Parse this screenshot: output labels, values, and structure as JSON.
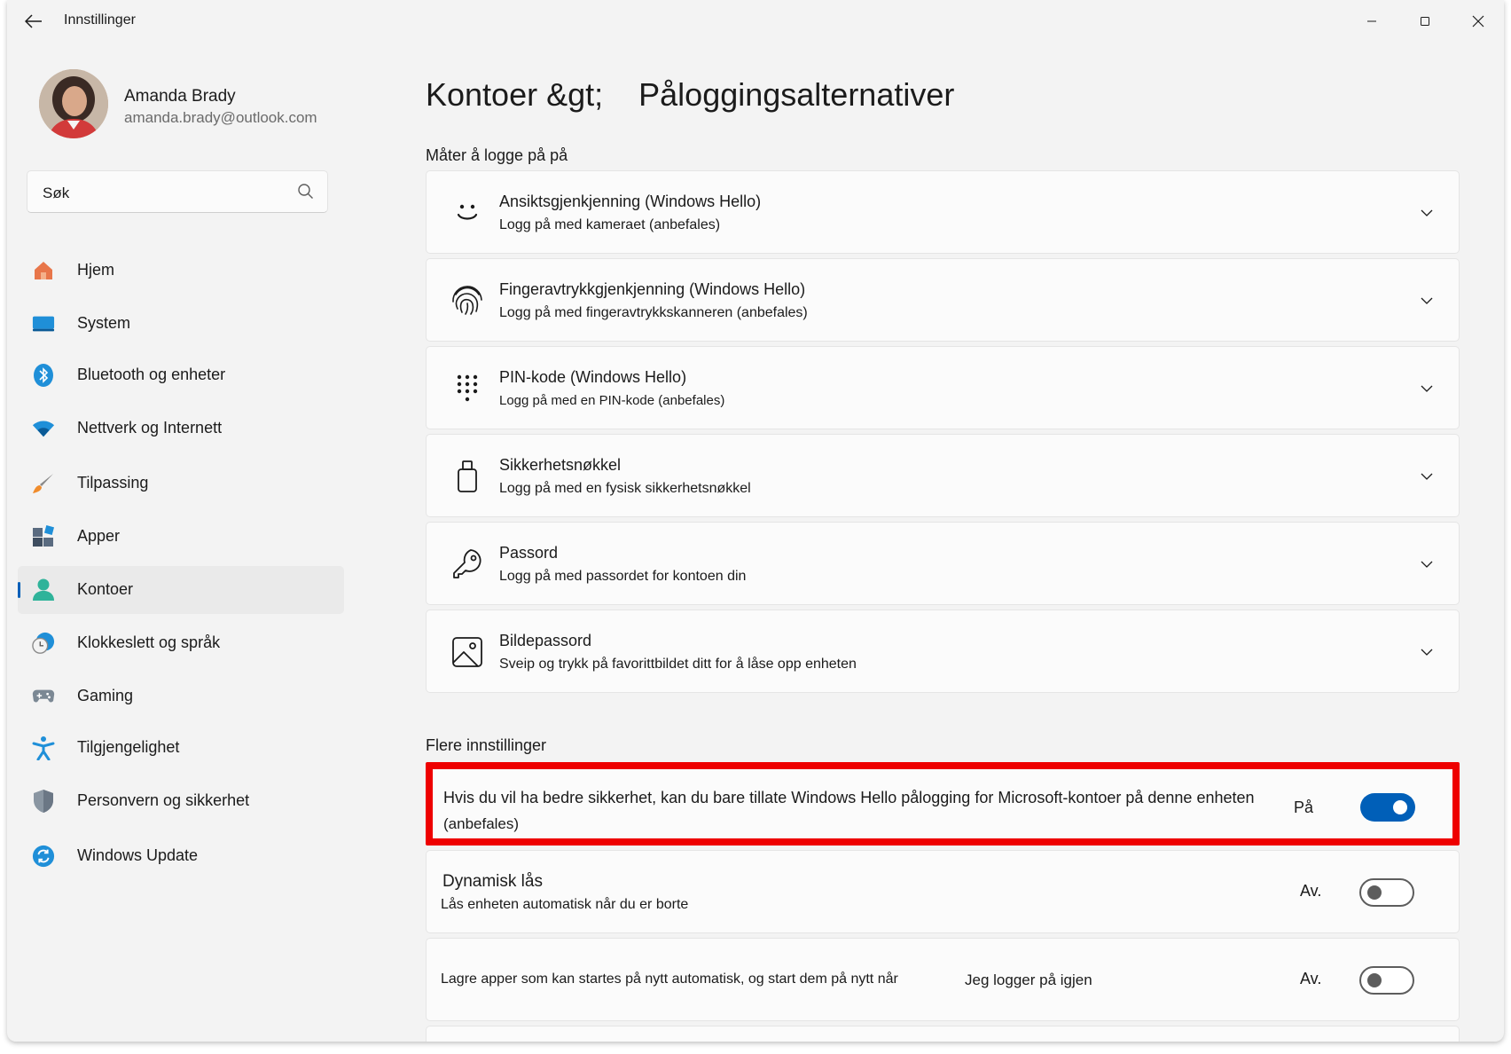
{
  "app": {
    "title": "Innstillinger"
  },
  "profile": {
    "name": "Amanda Brady",
    "email": "amanda.brady@outlook.com"
  },
  "search": {
    "placeholder": "Søk"
  },
  "nav": [
    {
      "label": "Hjem",
      "icon": "home-icon"
    },
    {
      "label": "System",
      "icon": "monitor-icon"
    },
    {
      "label": "Bluetooth og enheter",
      "icon": "bluetooth-icon"
    },
    {
      "label": "Nettverk og Internett",
      "icon": "wifi-icon"
    },
    {
      "label": "Tilpassing",
      "icon": "paintbrush-icon"
    },
    {
      "label": "Apper",
      "icon": "apps-icon"
    },
    {
      "label": "Kontoer",
      "icon": "person-icon",
      "selected": true
    },
    {
      "label": "Klokkeslett og språk",
      "icon": "clock-globe-icon"
    },
    {
      "label": "Gaming",
      "icon": "gamepad-icon"
    },
    {
      "label": "Tilgjengelighet",
      "icon": "accessibility-icon"
    },
    {
      "label": "Personvern og sikkerhet",
      "icon": "shield-icon"
    },
    {
      "label": "Windows Update",
      "icon": "refresh-icon"
    }
  ],
  "page": {
    "breadcrumb_parent": "Kontoer &gt;",
    "title": "Påloggingsalternativer"
  },
  "signin": {
    "section_title": "Måter å logge på på",
    "options": [
      {
        "title": "Ansiktsgjenkjenning (Windows Hello)",
        "subtitle": "Logg på med kameraet (anbefales)",
        "icon": "face-icon"
      },
      {
        "title": "Fingeravtrykkgjenkjenning (Windows Hello)",
        "subtitle": "Logg på med fingeravtrykkskanneren (anbefales)",
        "icon": "fingerprint-icon"
      },
      {
        "title": "PIN-kode (Windows Hello)",
        "subtitle": "Logg på med en  PIN-kode (anbefales)",
        "icon": "keypad-icon"
      },
      {
        "title": "Sikkerhetsnøkkel",
        "subtitle": "Logg på med en fysisk sikkerhetsnøkkel",
        "icon": "usb-key-icon"
      },
      {
        "title": "Passord",
        "subtitle": "Logg på med passordet for kontoen din",
        "icon": "key-icon"
      },
      {
        "title": "Bildepassord",
        "subtitle": "Sveip og trykk på favorittbildet ditt for å låse opp enheten",
        "icon": "picture-icon"
      }
    ]
  },
  "more": {
    "section_title": "Flere innstillinger",
    "hello_only": {
      "line1": "Hvis du vil ha bedre sikkerhet, kan du bare tillate Windows Hello pålogging for Microsoft-kontoer på denne enheten",
      "line2": "(anbefales)",
      "state": "På",
      "on": true
    },
    "dynamic_lock": {
      "title": "Dynamisk lås",
      "subtitle": "Lås enheten automatisk når du er borte",
      "state": "Av.",
      "on": false
    },
    "restart_apps": {
      "text": "Lagre apper som kan startes på nytt automatisk, og start dem på nytt når",
      "text_bold": "Jeg logger på igjen",
      "state": "Av.",
      "on": false
    }
  },
  "colors": {
    "accent": "#005fb8",
    "highlight": "#ee0000",
    "window_bg": "#f3f3f3",
    "card_bg": "#fbfbfb"
  }
}
